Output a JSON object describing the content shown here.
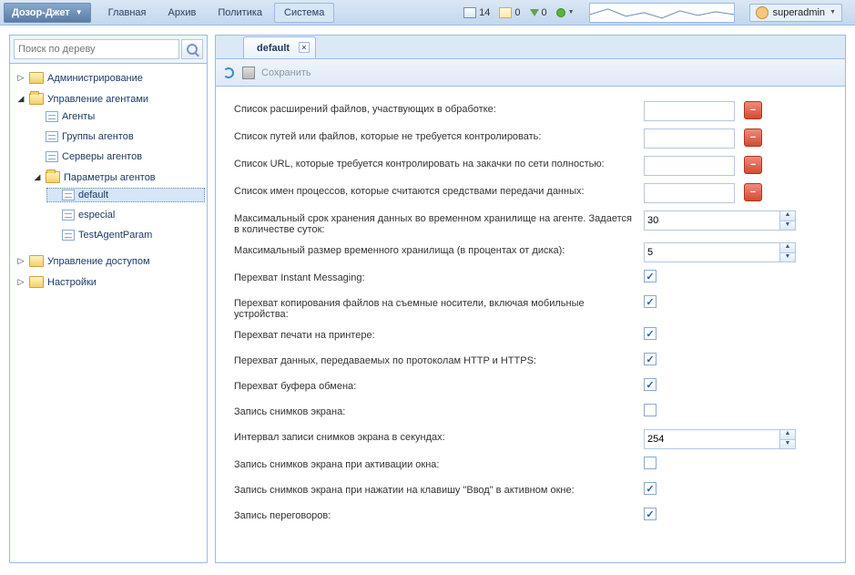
{
  "brand": "Дозор-Джет",
  "menu": [
    "Главная",
    "Архив",
    "Политика",
    "Система"
  ],
  "menu_active": 3,
  "stats": {
    "mail_new": "14",
    "mail_open": "0",
    "download": "0"
  },
  "user": "superadmin",
  "search_placeholder": "Поиск по дереву",
  "tree": [
    {
      "type": "folder",
      "label": "Администрирование",
      "expanded": false
    },
    {
      "type": "folder",
      "label": "Управление агентами",
      "expanded": true,
      "children": [
        {
          "type": "leaf",
          "label": "Агенты"
        },
        {
          "type": "leaf",
          "label": "Группы агентов"
        },
        {
          "type": "leaf",
          "label": "Серверы агентов"
        },
        {
          "type": "folder",
          "label": "Параметры агентов",
          "expanded": true,
          "children": [
            {
              "type": "leaf",
              "label": "default",
              "selected": true
            },
            {
              "type": "leaf",
              "label": "especial"
            },
            {
              "type": "leaf",
              "label": "TestAgentParam"
            }
          ]
        }
      ]
    },
    {
      "type": "folder",
      "label": "Управление доступом",
      "expanded": false
    },
    {
      "type": "folder",
      "label": "Настройки",
      "expanded": false
    }
  ],
  "tab_title": "default",
  "save_label": "Сохранить",
  "rows": [
    {
      "kind": "text",
      "label": "Список расширений файлов, участвующих в обработке:",
      "value": "",
      "del": true
    },
    {
      "kind": "text",
      "label": "Список путей или файлов, которые не требуется контролировать:",
      "value": "",
      "del": true
    },
    {
      "kind": "text",
      "label": "Список URL, которые требуется контролировать на закачки по сети полностью:",
      "value": "",
      "del": true
    },
    {
      "kind": "text",
      "label": "Список имен процессов, которые считаются средствами передачи данных:",
      "value": "",
      "del": true
    },
    {
      "kind": "spin",
      "label": "Максимальный срок хранения данных во временном хранилище на агенте. Задается в количестве суток:",
      "value": "30"
    },
    {
      "kind": "spin",
      "label": "Максимальный размер временного хранилища (в процентах от диска):",
      "value": "5"
    },
    {
      "kind": "check",
      "label": "Перехват Instant Messaging:",
      "checked": true
    },
    {
      "kind": "check",
      "label": "Перехват копирования файлов на съемные носители, включая мобильные устройства:",
      "checked": true
    },
    {
      "kind": "check",
      "label": "Перехват печати на принтере:",
      "checked": true
    },
    {
      "kind": "check",
      "label": "Перехват данных, передаваемых по протоколам HTTP и HTTPS:",
      "checked": true
    },
    {
      "kind": "check",
      "label": "Перехват буфера обмена:",
      "checked": true
    },
    {
      "kind": "check",
      "label": "Запись снимков экрана:",
      "checked": false
    },
    {
      "kind": "spin",
      "label": "Интервал записи снимков экрана в секундах:",
      "value": "254"
    },
    {
      "kind": "check",
      "label": "Запись снимков экрана при активации окна:",
      "checked": false
    },
    {
      "kind": "check",
      "label": "Запись снимков экрана при нажатии на клавишу \"Ввод\" в активном окне:",
      "checked": true
    },
    {
      "kind": "check",
      "label": "Запись переговоров:",
      "checked": true
    }
  ]
}
